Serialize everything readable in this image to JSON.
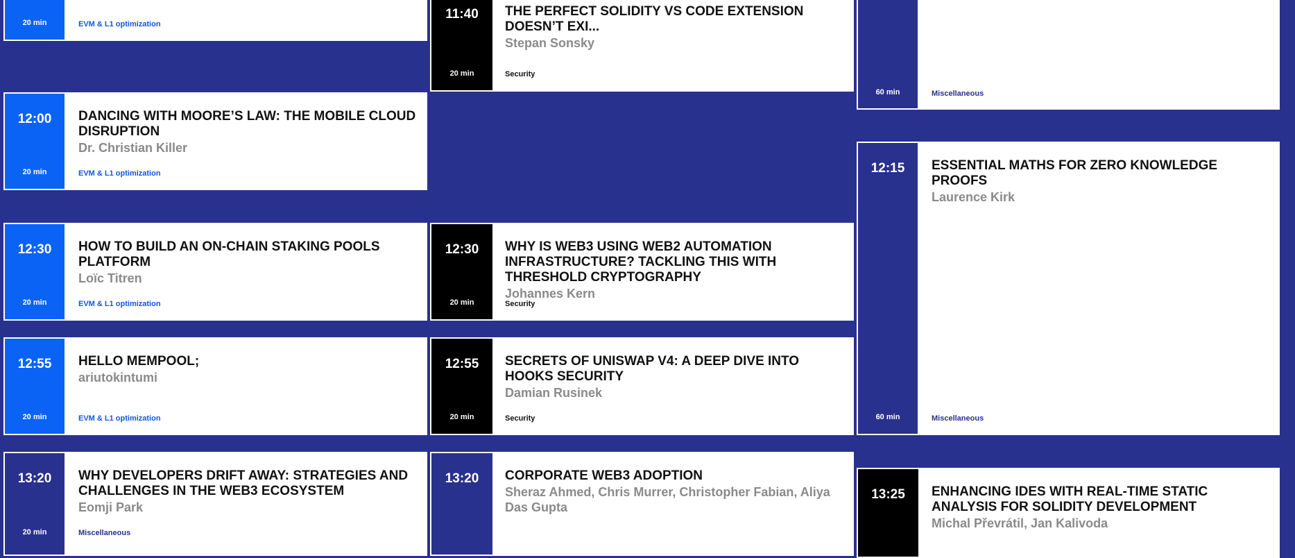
{
  "colors": {
    "background": "#29318e",
    "evm_track": "#0b63f6",
    "security_track": "#000000",
    "misc_track": "#29318e"
  },
  "sessions": {
    "c1_top": {
      "duration": "20 min",
      "track": "EVM & L1 optimization"
    },
    "c1_1200": {
      "time": "12:00",
      "title": "DANCING WITH MOORE’S LAW: THE MOBILE CLOUD DISRUPTION",
      "speaker": "Dr. Christian Killer",
      "duration": "20 min",
      "track": "EVM & L1 optimization"
    },
    "c1_1230": {
      "time": "12:30",
      "title": "HOW TO BUILD AN ON-CHAIN STAKING POOLS PLATFORM",
      "speaker": "Loïc Titren",
      "duration": "20 min",
      "track": "EVM & L1 optimization"
    },
    "c1_1255": {
      "time": "12:55",
      "title": "HELLO MEMPOOL;",
      "speaker": "ariutokintumi",
      "duration": "20 min",
      "track": "EVM & L1 optimization"
    },
    "c1_1320": {
      "time": "13:20",
      "title": "WHY DEVELOPERS DRIFT AWAY: STRATEGIES AND CHALLENGES IN THE WEB3 ECOSYSTEM",
      "speaker": "Eomji Park",
      "duration": "20 min",
      "track": "Miscellaneous"
    },
    "c2_1140": {
      "time": "11:40",
      "title": "THE PERFECT SOLIDITY VS CODE EXTENSION DOESN’T EXI...",
      "speaker": "Stepan Sonsky",
      "duration": "20 min",
      "track": "Security"
    },
    "c2_1230": {
      "time": "12:30",
      "title": "WHY IS WEB3 USING WEB2 AUTOMATION INFRASTRUCTURE? TACKLING THIS WITH THRESHOLD CRYPTOGRAPHY",
      "speaker": "Johannes Kern",
      "duration": "20 min",
      "track": "Security"
    },
    "c2_1255": {
      "time": "12:55",
      "title": "SECRETS OF UNISWAP V4: A DEEP DIVE INTO HOOKS SECURITY",
      "speaker": "Damian Rusinek",
      "duration": "20 min",
      "track": "Security"
    },
    "c2_1320": {
      "time": "13:20",
      "title": "CORPORATE WEB3 ADOPTION",
      "speaker": "Sheraz Ahmed, Chris Murrer, Christopher Fabian, Aliya Das Gupta"
    },
    "c3_top": {
      "duration": "60 min",
      "track": "Miscellaneous"
    },
    "c3_1215": {
      "time": "12:15",
      "title": "ESSENTIAL MATHS FOR ZERO KNOWLEDGE PROOFS",
      "speaker": "Laurence Kirk",
      "duration": "60 min",
      "track": "Miscellaneous"
    },
    "c3_1325": {
      "time": "13:25",
      "title": "ENHANCING IDES WITH REAL-TIME STATIC ANALYSIS FOR SOLIDITY DEVELOPMENT",
      "speaker": "Michal Převrátil, Jan Kalivoda"
    }
  }
}
